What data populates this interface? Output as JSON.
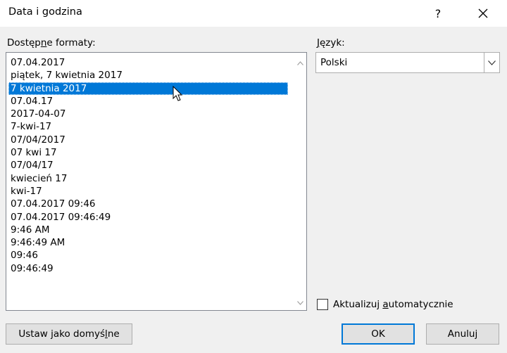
{
  "window": {
    "title": "Data i godzina",
    "help_label": "?"
  },
  "formats": {
    "label_before": "Dostęp",
    "label_mnemonic": "n",
    "label_after": "e formaty:",
    "selected_index": 2,
    "items": [
      "07.04.2017",
      "piątek, 7 kwietnia 2017",
      "7 kwietnia 2017",
      "07.04.17",
      "2017-04-07",
      "7-kwi-17",
      "07/04/2017",
      "07 kwi 17",
      "07/04/17",
      "kwiecień 17",
      "kwi-17",
      "07.04.2017 09:46",
      "07.04.2017 09:46:49",
      "9:46 AM",
      "9:46:49 AM",
      "09:46",
      "09:46:49"
    ]
  },
  "language": {
    "label_mnemonic": "J",
    "label_after": "ęzyk:",
    "value": "Polski"
  },
  "auto_update": {
    "label_before": "Aktualizuj ",
    "label_mnemonic": "a",
    "label_after": "utomatycznie",
    "checked": false
  },
  "buttons": {
    "set_default_before": "Ustaw jako domyś",
    "set_default_mnemonic": "l",
    "set_default_after": "ne",
    "ok": "OK",
    "cancel": "Anuluj"
  },
  "colors": {
    "selection": "#0078d7",
    "dialog_bg": "#f0f0f0"
  }
}
